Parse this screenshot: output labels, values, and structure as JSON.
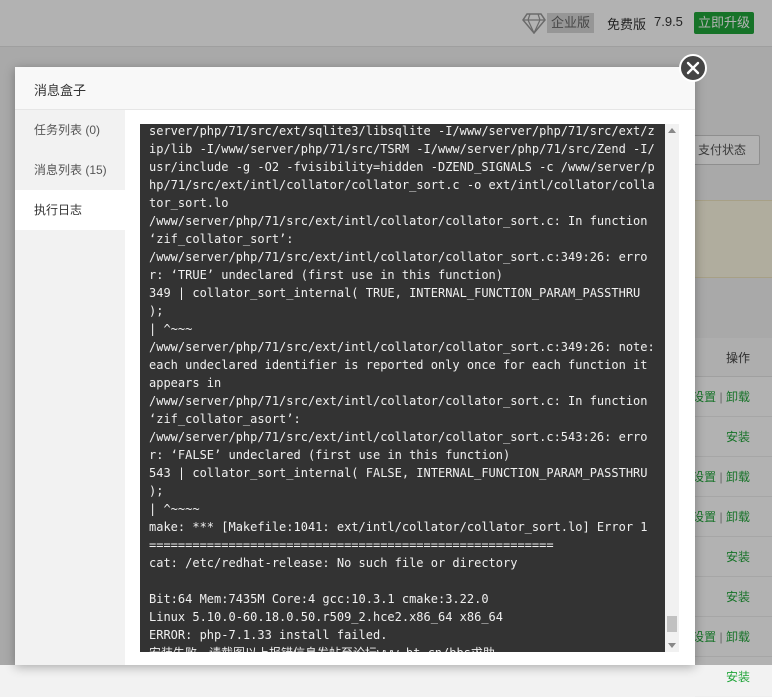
{
  "topbar": {
    "enterprise_badge": "企业版",
    "free_label": "免费版",
    "version": "7.9.5",
    "upgrade_button": "立即升级",
    "gem_icon": "diamond-icon"
  },
  "background": {
    "pay_status_button": "支付状态",
    "table_header_operation": "操作",
    "rows": [
      {
        "actions": [
          "设置",
          "卸载"
        ]
      },
      {
        "actions": [
          "安装"
        ]
      },
      {
        "actions": [
          "设置",
          "卸载"
        ]
      },
      {
        "actions": [
          "设置",
          "卸载"
        ]
      },
      {
        "actions": [
          "安装"
        ]
      },
      {
        "actions": [
          "安装"
        ]
      },
      {
        "actions": [
          "设置",
          "卸载"
        ]
      },
      {
        "actions": [
          "安装"
        ]
      }
    ],
    "action_separator": "|"
  },
  "modal": {
    "title": "消息盒子",
    "close_icon": "close-icon",
    "nav": [
      {
        "label": "任务列表 (0)",
        "active": false
      },
      {
        "label": "消息列表 (15)",
        "active": false
      },
      {
        "label": "执行日志",
        "active": true
      }
    ],
    "log_lines": [
      "server/php/71/src/ext/sqlite3/libsqlite -I/www/server/php/71/src/ext/z",
      "ip/lib -I/www/server/php/71/src/TSRM -I/www/server/php/71/src/Zend -I/",
      "usr/include -g -O2 -fvisibility=hidden -DZEND_SIGNALS -c /www/server/p",
      "hp/71/src/ext/intl/collator/collator_sort.c -o ext/intl/collator/colla",
      "tor_sort.lo",
      "/www/server/php/71/src/ext/intl/collator/collator_sort.c: In function",
      "‘zif_collator_sort’:",
      "/www/server/php/71/src/ext/intl/collator/collator_sort.c:349:26: erro",
      "r: ‘TRUE’ undeclared (first use in this function)",
      "349 | collator_sort_internal( TRUE, INTERNAL_FUNCTION_PARAM_PASSTHRU",
      ");",
      "| ^~~~",
      "/www/server/php/71/src/ext/intl/collator/collator_sort.c:349:26: note:",
      "each undeclared identifier is reported only once for each function it",
      "appears in",
      "/www/server/php/71/src/ext/intl/collator/collator_sort.c: In function",
      "‘zif_collator_asort’:",
      "/www/server/php/71/src/ext/intl/collator/collator_sort.c:543:26: erro",
      "r: ‘FALSE’ undeclared (first use in this function)",
      "543 | collator_sort_internal( FALSE, INTERNAL_FUNCTION_PARAM_PASSTHRU",
      ");",
      "| ^~~~~",
      "make: *** [Makefile:1041: ext/intl/collator/collator_sort.lo] Error 1",
      "========================================================",
      "cat: /etc/redhat-release: No such file or directory",
      "",
      "Bit:64 Mem:7435M Core:4 gcc:10.3.1 cmake:3.22.0",
      "Linux 5.10.0-60.18.0.50.r509_2.hce2.x86_64 x86_64",
      "ERROR: php-7.1.33 install failed.",
      "安装失败，请截图以上报错信息发帖至论坛www.bt.cn/bbs求助"
    ]
  },
  "colors": {
    "brand_green": "#20a53a",
    "log_background": "#333333",
    "log_text": "#f0f0f0"
  }
}
